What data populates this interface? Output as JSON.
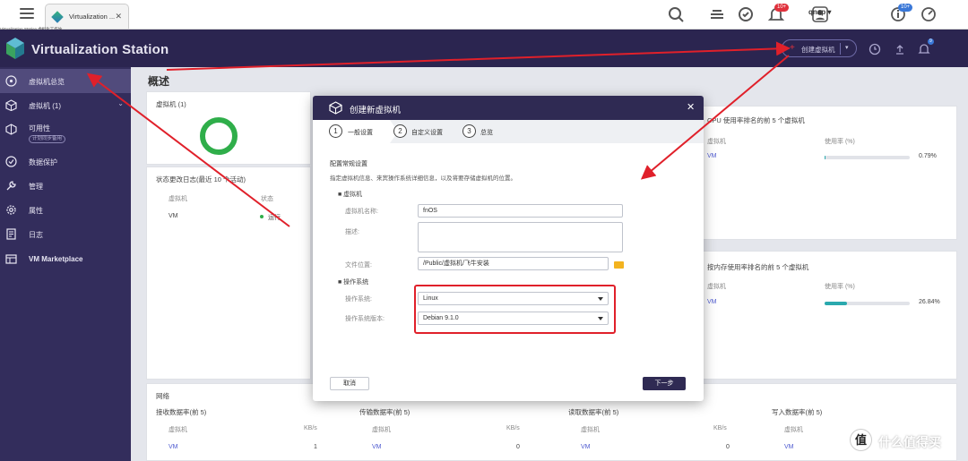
{
  "qts": {
    "tab_title": "Virtualization ...",
    "status_text": "Virtualization Station 虚拟化工作站",
    "notification_badge": "10+",
    "user": "qnap ▾",
    "info_badge": "10+"
  },
  "app": {
    "title": "Virtualization Station",
    "create_button": "创建虚拟机",
    "notification_badge": "9"
  },
  "sidebar": {
    "items": [
      {
        "label": "虚拟机总览",
        "icon": "dashboard-icon"
      },
      {
        "label": "虚拟机 (1)",
        "icon": "vm-cube-icon"
      },
      {
        "label": "可用性",
        "icon": "availability-icon"
      },
      {
        "label": "数据保护",
        "icon": "data-protection-icon"
      },
      {
        "label": "管理",
        "icon": "wrench-icon"
      },
      {
        "label": "属性",
        "icon": "gear-icon"
      },
      {
        "label": "日志",
        "icon": "log-icon"
      },
      {
        "label": "VM Marketplace",
        "icon": "marketplace-icon"
      }
    ],
    "availability_tag": "计划同步备用"
  },
  "main": {
    "page_title": "概述",
    "vm_card_title": "虚拟机 (1)",
    "log_title": "状态更改日志(最近 10 个活动)",
    "log_headers": [
      "虚拟机",
      "状态"
    ],
    "log_row": {
      "vm": "VM",
      "status": "运行"
    },
    "cpu_title": "CPU 使用率排名的前 5 个虚拟机",
    "cpu_headers": [
      "虚拟机",
      "使用率 (%)"
    ],
    "cpu_row": {
      "vm": "VM",
      "value": "0.79%",
      "fraction": 0.0079
    },
    "mem_title": "按内存使用率排名的前 5 个虚拟机",
    "mem_headers": [
      "虚拟机",
      "使用率 (%)"
    ],
    "mem_row": {
      "vm": "VM",
      "value": "26.84%",
      "fraction": 0.2684
    },
    "network_title": "网络",
    "net_cols": [
      {
        "title": "接收数据率(前 5)",
        "h1": "虚拟机",
        "h2": "KB/s",
        "vm": "VM",
        "value": "1"
      },
      {
        "title": "传输数据率(前 5)",
        "h1": "虚拟机",
        "h2": "KB/s",
        "vm": "VM",
        "value": "0"
      },
      {
        "title": "读取数据率(前 5)",
        "h1": "虚拟机",
        "h2": "KB/s",
        "vm": "VM",
        "value": "0"
      },
      {
        "title": "写入数据率(前 5)",
        "h1": "虚拟机",
        "h2": "",
        "vm": "VM",
        "value": ""
      }
    ]
  },
  "dialog": {
    "title": "创建新虚拟机",
    "steps": [
      {
        "num": "1",
        "label": "一般设置"
      },
      {
        "num": "2",
        "label": "自定义设置"
      },
      {
        "num": "3",
        "label": "总览"
      }
    ],
    "section_title": "配置常规设置",
    "section_desc": "指定虚拟机信息、来宾操作系统详细信息，以及将要存储虚拟机的位置。",
    "vm_group": "■ 虚拟机",
    "name_label": "虚拟机名称:",
    "name_value": "fnOS",
    "desc_label": "描述:",
    "desc_value": "",
    "location_label": "文件位置:",
    "location_value": "/Public/虚拟机/飞牛安装",
    "os_group": "■ 操作系统",
    "os_label": "操作系统:",
    "os_value": "Linux",
    "os_version_label": "操作系统版本:",
    "os_version_value": "Debian 9.1.0",
    "cancel": "取消",
    "next": "下一步"
  },
  "watermark": {
    "symbol": "值",
    "text": "什么值得买"
  },
  "colors": {
    "accent": "#2f2a53",
    "sidebar": "#332d5c",
    "highlight": "#e0202a",
    "gauge": "#2fae4a"
  }
}
